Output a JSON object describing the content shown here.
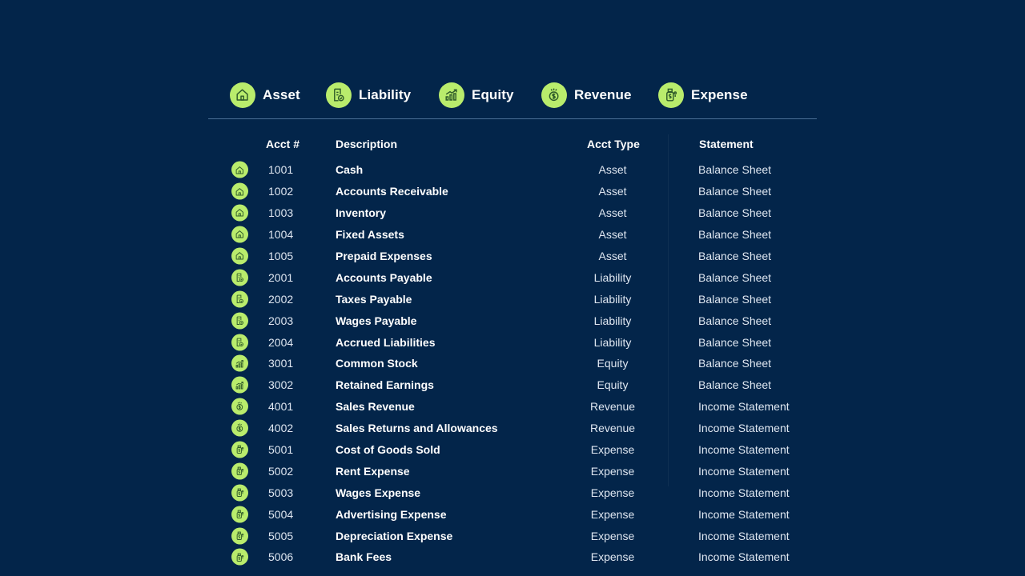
{
  "colors": {
    "background": "#03254a",
    "accent": "#b9ec6c",
    "icon_stroke": "#2f5b2a",
    "text": "#ffffff",
    "muted_text": "#dfe7f1"
  },
  "legend": [
    {
      "label": "Asset",
      "icon": "house-icon"
    },
    {
      "label": "Liability",
      "icon": "document-check-icon"
    },
    {
      "label": "Equity",
      "icon": "bar-chart-growth-icon"
    },
    {
      "label": "Revenue",
      "icon": "dollar-coin-icon"
    },
    {
      "label": "Expense",
      "icon": "money-bag-icon"
    }
  ],
  "table": {
    "headers": {
      "acct": "Acct #",
      "description": "Description",
      "type": "Acct Type",
      "statement": "Statement"
    },
    "rows": [
      {
        "acct": "1001",
        "description": "Cash",
        "type": "Asset",
        "statement": "Balance Sheet"
      },
      {
        "acct": "1002",
        "description": "Accounts Receivable",
        "type": "Asset",
        "statement": "Balance Sheet"
      },
      {
        "acct": "1003",
        "description": "Inventory",
        "type": "Asset",
        "statement": "Balance Sheet"
      },
      {
        "acct": "1004",
        "description": "Fixed Assets",
        "type": "Asset",
        "statement": "Balance Sheet"
      },
      {
        "acct": "1005",
        "description": "Prepaid Expenses",
        "type": "Asset",
        "statement": "Balance Sheet"
      },
      {
        "acct": "2001",
        "description": "Accounts Payable",
        "type": "Liability",
        "statement": "Balance Sheet"
      },
      {
        "acct": "2002",
        "description": "Taxes Payable",
        "type": "Liability",
        "statement": "Balance Sheet"
      },
      {
        "acct": "2003",
        "description": "Wages Payable",
        "type": "Liability",
        "statement": "Balance Sheet"
      },
      {
        "acct": "2004",
        "description": "Accrued Liabilities",
        "type": "Liability",
        "statement": "Balance Sheet"
      },
      {
        "acct": "3001",
        "description": "Common Stock",
        "type": "Equity",
        "statement": "Balance Sheet"
      },
      {
        "acct": "3002",
        "description": "Retained Earnings",
        "type": "Equity",
        "statement": "Balance Sheet"
      },
      {
        "acct": "4001",
        "description": "Sales Revenue",
        "type": "Revenue",
        "statement": "Income Statement"
      },
      {
        "acct": "4002",
        "description": "Sales Returns and Allowances",
        "type": "Revenue",
        "statement": "Income Statement"
      },
      {
        "acct": "5001",
        "description": "Cost of Goods Sold",
        "type": "Expense",
        "statement": "Income Statement"
      },
      {
        "acct": "5002",
        "description": "Rent Expense",
        "type": "Expense",
        "statement": "Income Statement"
      },
      {
        "acct": "5003",
        "description": "Wages Expense",
        "type": "Expense",
        "statement": "Income Statement"
      },
      {
        "acct": "5004",
        "description": "Advertising Expense",
        "type": "Expense",
        "statement": "Income Statement"
      },
      {
        "acct": "5005",
        "description": "Depreciation Expense",
        "type": "Expense",
        "statement": "Income Statement"
      },
      {
        "acct": "5006",
        "description": "Bank Fees",
        "type": "Expense",
        "statement": "Income Statement"
      }
    ]
  }
}
